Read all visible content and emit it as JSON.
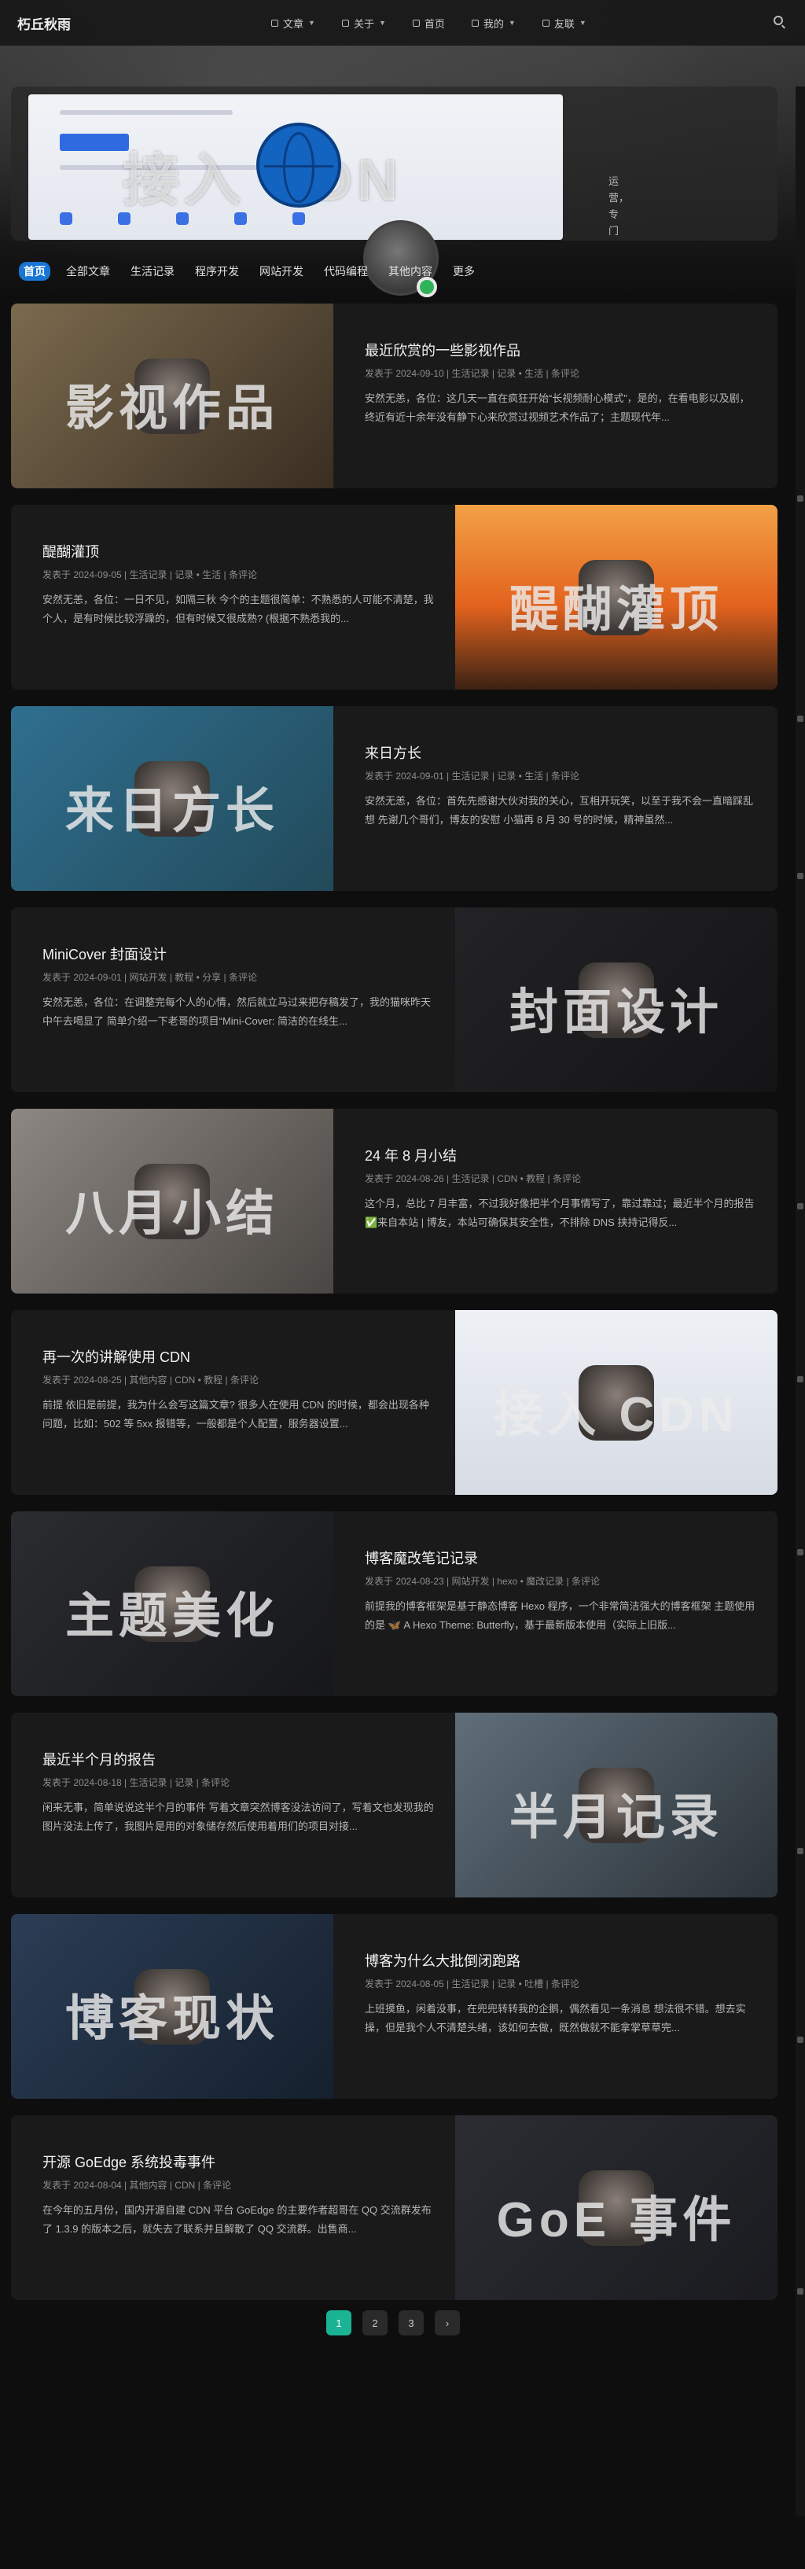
{
  "nav": {
    "brand": "朽丘秋雨",
    "menu": [
      {
        "label": "文章",
        "icon": "book-icon",
        "has_dropdown": true
      },
      {
        "label": "关于",
        "icon": "user-icon",
        "has_dropdown": true
      },
      {
        "label": "首页",
        "icon": "home-icon",
        "has_dropdown": false
      },
      {
        "label": "我的",
        "icon": "heart-icon",
        "has_dropdown": true
      },
      {
        "label": "友联",
        "icon": "link-icon",
        "has_dropdown": true
      }
    ],
    "search_icon": "search-icon"
  },
  "feature": {
    "overlay": "接入  CDN",
    "side_text": "运营，专门定制了为各位博主们免费提"
  },
  "categories": [
    "首页",
    "全部文章",
    "生活记录",
    "程序开发",
    "网站开发",
    "代码编程",
    "其他内容",
    "更多"
  ],
  "posts": [
    {
      "title": "最近欣赏的一些影视作品",
      "meta": "发表于 2024-09-10 | 生活记录 | 记录 • 生活 | 条评论",
      "excerpt": "安然无恙，各位：这几天一直在疯狂开始“长视频耐心模式”，是的，在看电影以及剧，终近有近十余年没有静下心来欣赏过视频艺术作品了；主题现代年...",
      "cover_text": "影视作品",
      "side": "left"
    },
    {
      "title": "醍醐灌顶",
      "meta": "发表于 2024-09-05 | 生活记录 | 记录 • 生活 | 条评论",
      "excerpt": "安然无恙，各位：一日不见，如隔三秋 今个的主题很简单：不熟悉的人可能不清楚，我个人，是有时候比较浮躁的，但有时候又很成熟? (根据不熟悉我的...",
      "cover_text": "醍醐灌顶",
      "side": "right"
    },
    {
      "title": "来日方长",
      "meta": "发表于 2024-09-01 | 生活记录 | 记录 • 生活 | 条评论",
      "excerpt": "安然无恙，各位：首先先感谢大伙对我的关心，互相开玩笑，以至于我不会一直暗踩乱想 先谢几个哥们，博友的安慰 小猫再 8 月 30 号的时候，精神虽然...",
      "cover_text": "来日方长",
      "side": "left"
    },
    {
      "title": "MiniCover 封面设计",
      "meta": "发表于 2024-09-01 | 网站开发 | 教程 • 分享 | 条评论",
      "excerpt": "安然无恙，各位：在调整完每个人的心情，然后就立马过来把存稿发了，我的猫咪昨天中午去喝显了 简单介绍一下老哥的项目“Mini-Cover: 简洁的在线生...",
      "cover_text": "封面设计",
      "side": "right"
    },
    {
      "title": "24 年 8 月小结",
      "meta": "发表于 2024-08-26 | 生活记录 | CDN • 教程 | 条评论",
      "excerpt": "这个月，总比 7 月丰富，不过我好像把半个月事情写了，靠过靠过；最近半个月的报告 ✅来自本站 | 博友，本站可确保其安全性，不排除 DNS 挟持记得反...",
      "cover_text": "八月小结",
      "side": "left"
    },
    {
      "title": "再一次的讲解使用 CDN",
      "meta": "发表于 2024-08-25 | 其他内容 | CDN • 教程 | 条评论",
      "excerpt": "前提 依旧是前提，我为什么会写这篇文章? 很多人在使用 CDN 的时候，都会出现各种问题，比如：502 等 5xx 报错等，一般都是个人配置，服务器设置...",
      "cover_text": "接入 CDN",
      "side": "right"
    },
    {
      "title": "博客魔改笔记记录",
      "meta": "发表于 2024-08-23 | 网站开发 | hexo • 魔改记录 | 条评论",
      "excerpt": "前提我的博客框架是基于静态博客 Hexo 程序，一个非常简洁强大的博客框架 主题使用的是 🦋 A Hexo Theme: Butterfly，基于最新版本使用（实际上旧版...",
      "cover_text": "主题美化",
      "side": "left"
    },
    {
      "title": "最近半个月的报告",
      "meta": "发表于 2024-08-18 | 生活记录 | 记录 | 条评论",
      "excerpt": "闲来无事，简单说说这半个月的事件 写着文章突然博客没法访问了，写着文也发现我的图片没法上传了，我图片是用的对象储存然后使用着用们的项目对接...",
      "cover_text": "半月记录",
      "side": "right"
    },
    {
      "title": "博客为什么大批倒闭跑路",
      "meta": "发表于 2024-08-05 | 生活记录 | 记录 • 吐槽 | 条评论",
      "excerpt": "上班摸鱼，闲着没事，在兜兜转转我的企鹅，偶然看见一条消息 想法很不错。想去实操，但是我个人不清楚头绪，该如何去做，既然做就不能拿掌草草完...",
      "cover_text": "博客现状",
      "side": "left"
    },
    {
      "title": "开源 GoEdge 系统投毒事件",
      "meta": "发表于 2024-08-04 | 其他内容 | CDN | 条评论",
      "excerpt": "在今年的五月份，国内开源自建 CDN 平台 GoEdge 的主要作者超哥在 QQ 交流群发布了 1.3.9 的版本之后，就失去了联系并且解散了 QQ 交流群。出售商...",
      "cover_text": "GoE 事件",
      "side": "right"
    }
  ],
  "pagination": [
    "1",
    "2",
    "3",
    "›"
  ],
  "colors": {
    "accent_tab": "#1976d2",
    "page_current": "#1ab394",
    "status_online": "#2fb35a"
  }
}
